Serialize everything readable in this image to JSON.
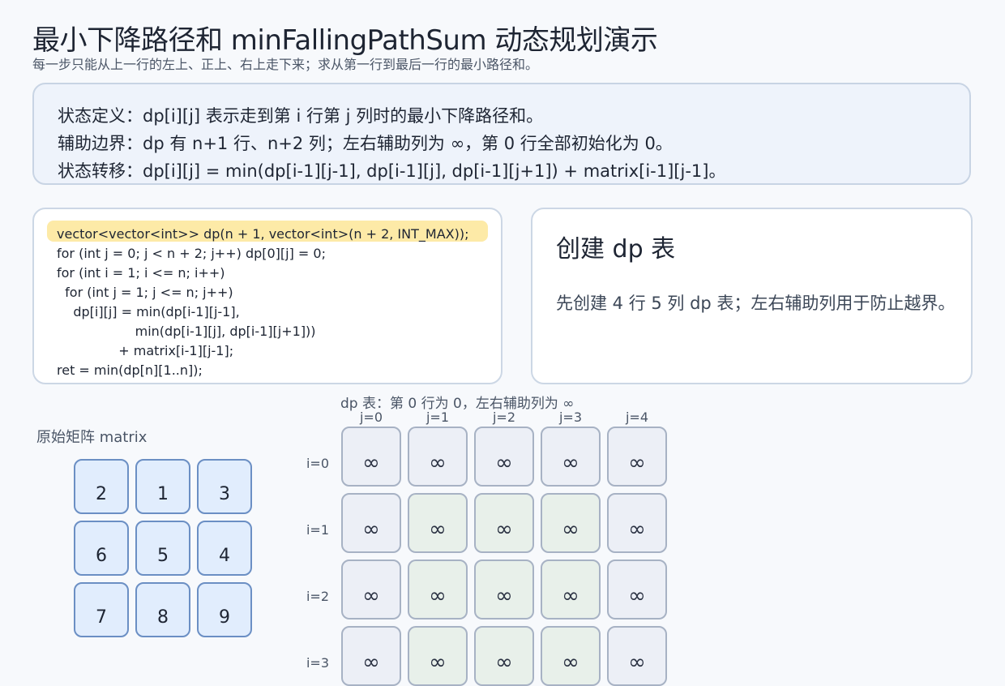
{
  "header": {
    "title": "最小下降路径和 minFallingPathSum 动态规划演示",
    "subtitle": "每一步只能从上一行的左上、正上、右上走下来；求从第一行到最后一行的最小路径和。"
  },
  "definitions": [
    "状态定义：dp[i][j] 表示走到第 i 行第 j 列时的最小下降路径和。",
    "辅助边界：dp 有 n+1 行、n+2 列；左右辅助列为 ∞，第 0 行全部初始化为 0。",
    "状态转移：dp[i][j] = min(dp[i-1][j-1], dp[i-1][j], dp[i-1][j+1]) + matrix[i-1][j-1]。"
  ],
  "code": {
    "lines": [
      "vector<vector<int>> dp(n + 1, vector<int>(n + 2, INT_MAX));",
      "for (int j = 0; j < n + 2; j++) dp[0][j] = 0;",
      "for (int i = 1; i <= n; i++)",
      "  for (int j = 1; j <= n; j++)",
      "    dp[i][j] = min(dp[i-1][j-1],",
      "                   min(dp[i-1][j], dp[i-1][j+1]))",
      "               + matrix[i-1][j-1];",
      "ret = min(dp[n][1..n]);"
    ],
    "highlighted_line": 0
  },
  "step": {
    "title": "创建 dp 表",
    "description": "先创建 4 行 5 列 dp 表；左右辅助列用于防止越界。"
  },
  "matrix": {
    "caption": "原始矩阵 matrix",
    "rows": [
      [
        "2",
        "1",
        "3"
      ],
      [
        "6",
        "5",
        "4"
      ],
      [
        "7",
        "8",
        "9"
      ]
    ]
  },
  "dp": {
    "caption": "dp 表：第 0 行为 0，左右辅助列为 ∞",
    "col_labels": [
      "j=0",
      "j=1",
      "j=2",
      "j=3",
      "j=4"
    ],
    "row_labels": [
      "i=0",
      "i=1",
      "i=2",
      "i=3"
    ],
    "rows": [
      [
        "∞",
        "∞",
        "∞",
        "∞",
        "∞"
      ],
      [
        "∞",
        "∞",
        "∞",
        "∞",
        "∞"
      ],
      [
        "∞",
        "∞",
        "∞",
        "∞",
        "∞"
      ],
      [
        "∞",
        "∞",
        "∞",
        "∞",
        "∞"
      ]
    ]
  }
}
